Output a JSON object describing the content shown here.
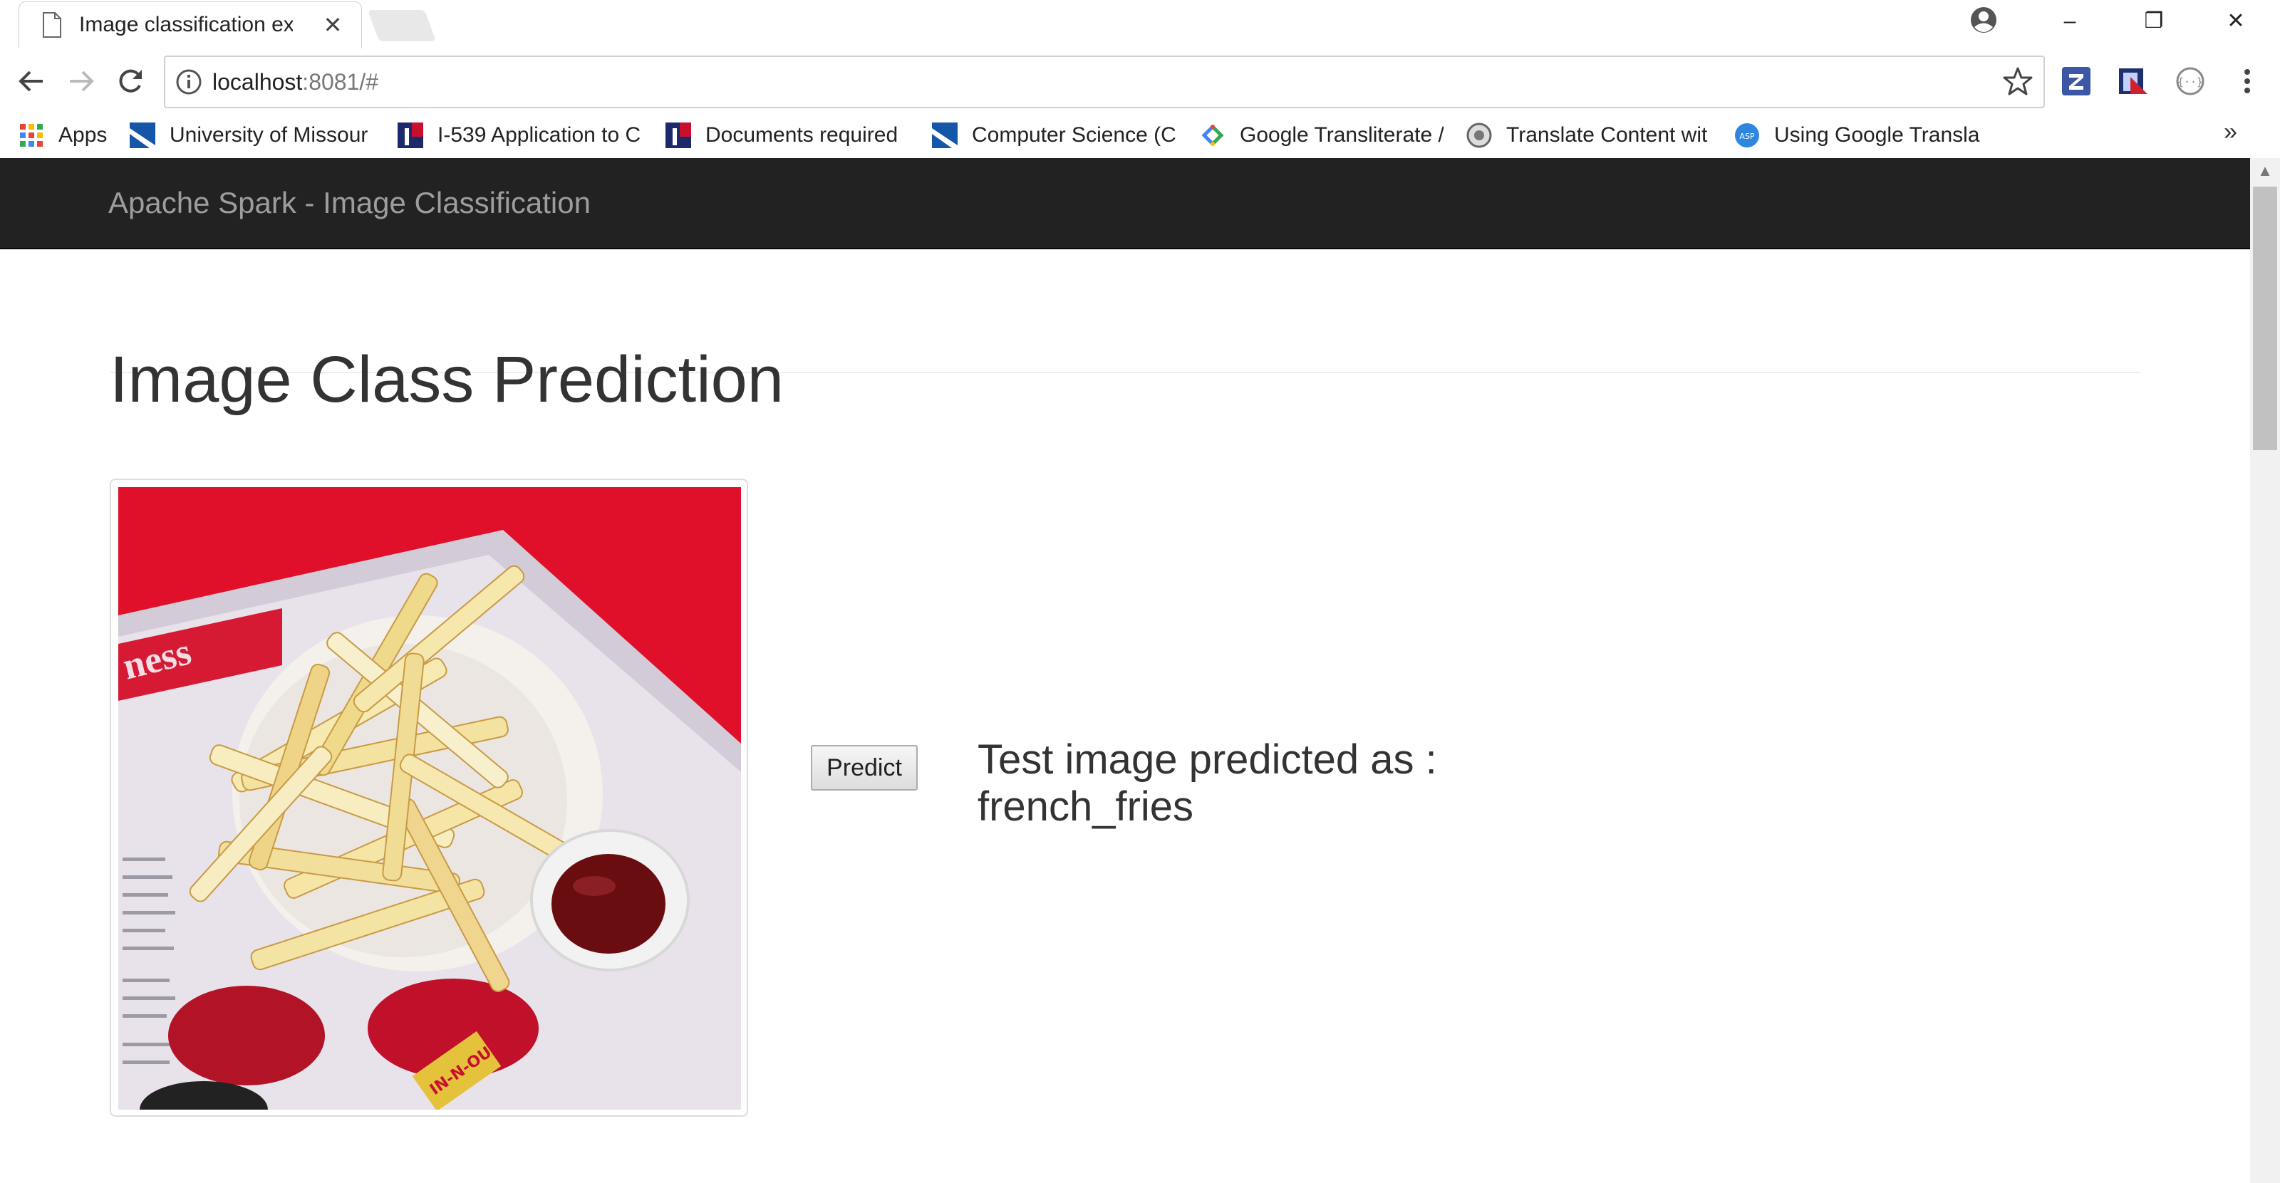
{
  "browser": {
    "tab": {
      "title": "Image classification exam",
      "close_glyph": "✕",
      "icon": "page-icon"
    },
    "window_controls": {
      "minimize": "–",
      "restore": "❐",
      "close": "✕"
    },
    "address_bar": {
      "host": "localhost",
      "rest": ":8081/#"
    },
    "bookmarks": [
      {
        "label": "Apps",
        "icon": "apps-grid-icon"
      },
      {
        "label": "University of Missour",
        "icon": "university-icon"
      },
      {
        "label": "I-539 Application to C",
        "icon": "uscis-icon"
      },
      {
        "label": "Documents required",
        "icon": "uscis-icon"
      },
      {
        "label": "Computer Science (C",
        "icon": "university-icon"
      },
      {
        "label": "Google Transliterate /",
        "icon": "google-icon"
      },
      {
        "label": "Translate Content wit",
        "icon": "translate-icon"
      },
      {
        "label": "Using Google Transla",
        "icon": "asp-icon"
      }
    ],
    "bookmarks_more": "»",
    "extensions": [
      "z-extension-icon",
      "reader-extension-icon",
      "json-extension-icon"
    ]
  },
  "app": {
    "brand": "Apache Spark - Image Classification",
    "page_title": "Image Class Prediction",
    "predict_label": "Predict",
    "result_line1": "Test image predicted as :",
    "result_line2": "french_fries"
  },
  "colors": {
    "navbar": "#222222",
    "brand_text": "#9d9d9d",
    "tray_red": "#e0102a"
  }
}
